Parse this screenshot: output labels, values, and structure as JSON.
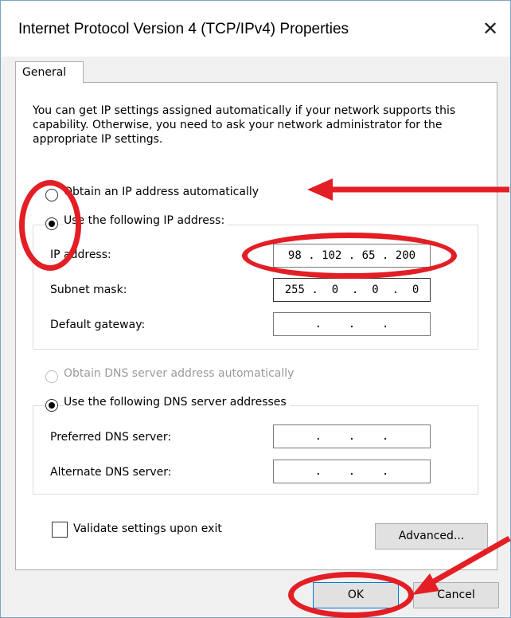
{
  "window": {
    "title": "Internet Protocol Version 4 (TCP/IPv4) Properties",
    "close_glyph": "✕"
  },
  "tabs": [
    {
      "label": "General",
      "selected": true
    }
  ],
  "description": "You can get IP settings assigned automatically if your network supports this capability. Otherwise, you need to ask your network administrator for the appropriate IP settings.",
  "ip_section": {
    "auto_option": {
      "label": "Obtain an IP address automatically",
      "selected": false
    },
    "manual_option": {
      "label": "Use the following IP address:",
      "selected": true
    },
    "fields": [
      {
        "label": "IP address:",
        "value": "98 . 102 . 65 . 200"
      },
      {
        "label": "Subnet mask:",
        "value": "255 .  0  .  0  .  0"
      },
      {
        "label": "Default gateway:",
        "value": "   .    .    .   "
      }
    ]
  },
  "dns_section": {
    "auto_option": {
      "label": "Obtain DNS server address automatically",
      "selected": false,
      "disabled": true
    },
    "manual_option": {
      "label": "Use the following DNS server addresses",
      "selected": true
    },
    "fields": [
      {
        "label": "Preferred DNS server:",
        "value": "   .    .    .   "
      },
      {
        "label": "Alternate DNS server:",
        "value": "   .    .    .   "
      }
    ]
  },
  "validate_checkbox": {
    "label": "Validate settings upon exit",
    "checked": false
  },
  "buttons": {
    "advanced": "Advanced...",
    "ok": "OK",
    "cancel": "Cancel"
  },
  "annotation_color": "#e31e24"
}
